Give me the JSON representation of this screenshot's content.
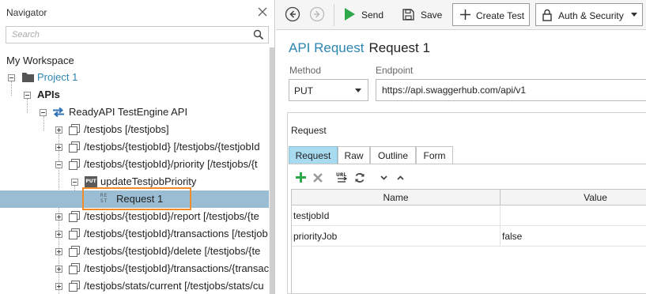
{
  "navigator": {
    "title": "Navigator",
    "search_placeholder": "Search",
    "workspace_label": "My Workspace",
    "tree": {
      "project": "Project 1",
      "apis": "APIs",
      "api": "ReadyAPI TestEngine API",
      "items": [
        "/testjobs [/testjobs]",
        "/testjobs/{testjobId} [/testjobs/{testjobId",
        "/testjobs/{testjobId}/priority [/testjobs/{t",
        "updateTestjobPriority",
        "Request 1",
        "/testjobs/{testjobId}/report [/testjobs/{te",
        "/testjobs/{testjobId}/transactions [/testjob",
        "/testjobs/{testjobId}/delete [/testjobs/{te",
        "/testjobs/{testjobId}/transactions/{transac",
        "/testjobs/stats/current [/testjobs/stats/cu"
      ],
      "put_badge": "PUT",
      "rest_badge_top": "RE",
      "rest_badge_bottom": "ST"
    }
  },
  "toolbar": {
    "send": "Send",
    "save": "Save",
    "create_test": "Create Test",
    "auth_security": "Auth & Security"
  },
  "request": {
    "kind": "API Request",
    "name": "Request 1",
    "method_label": "Method",
    "method_value": "PUT",
    "endpoint_label": "Endpoint",
    "endpoint_value": "https://api.swaggerhub.com/api/v1",
    "section_label": "Request",
    "tabs": [
      "Request",
      "Raw",
      "Outline",
      "Form"
    ],
    "grid": {
      "columns": [
        "Name",
        "Value"
      ],
      "rows": [
        {
          "name": "testjobId",
          "value": ""
        },
        {
          "name": "priorityJob",
          "value": "false"
        }
      ]
    }
  },
  "colors": {
    "accent": "#2d86b0",
    "selected_row": "#9bbdd3",
    "highlight": "#f08c2b",
    "active_tab": "#a9dbf0",
    "send_green": "#2da84a"
  }
}
